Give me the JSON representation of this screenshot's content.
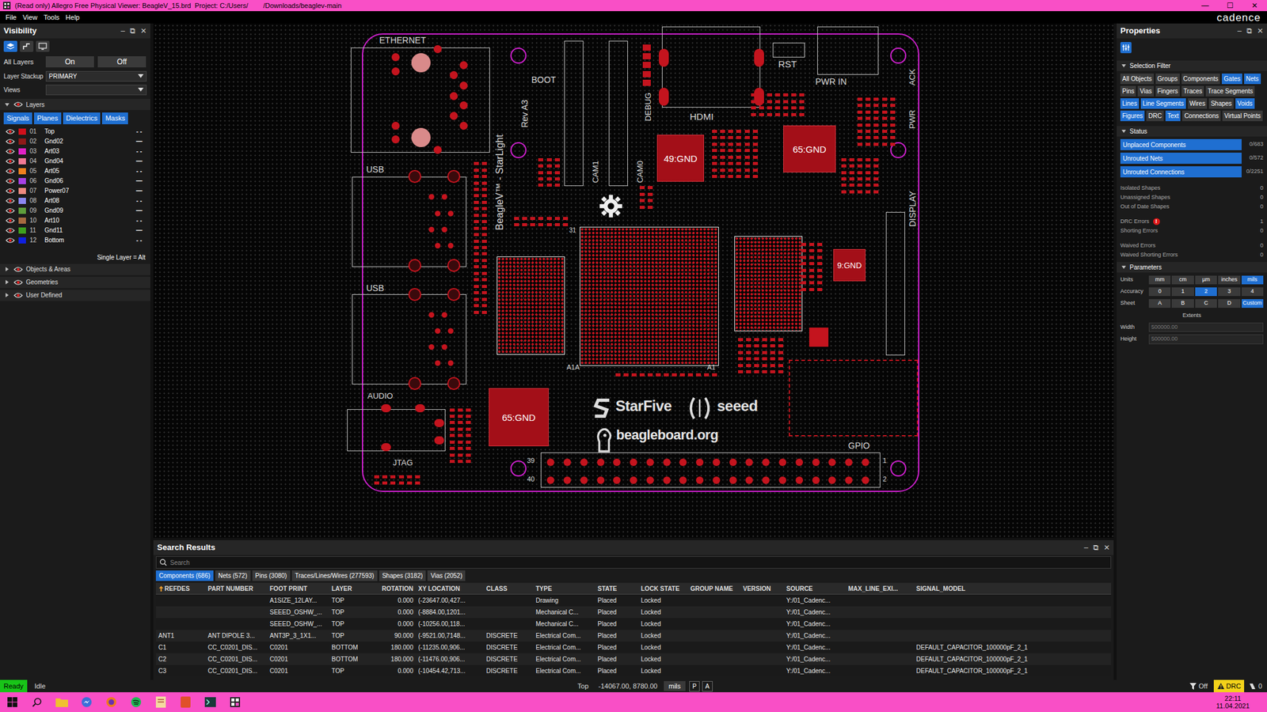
{
  "window": {
    "title": "(Read only) Allegro Free Physical Viewer: BeagleV_15.brd  Project: C:/Users/        /Downloads/beaglev-main",
    "controls": [
      "—",
      "☐",
      "✕"
    ]
  },
  "menu": [
    "File",
    "View",
    "Tools",
    "Help"
  ],
  "brand": "cadence",
  "visibility": {
    "title": "Visibility",
    "controls": [
      "–",
      "⧉",
      "✕"
    ],
    "view_tabs": [
      {
        "selected": true
      },
      {
        "selected": false
      },
      {
        "selected": false
      }
    ],
    "all_layers": {
      "label": "All Layers",
      "on": "On",
      "off": "Off"
    },
    "stackup": {
      "label": "Layer Stackup",
      "value": "PRIMARY"
    },
    "views": {
      "label": "Views",
      "value": ""
    },
    "layers_title": "Layers",
    "layers_expanded": true,
    "filters": [
      {
        "label": "Signals",
        "selected": true
      },
      {
        "label": "Planes",
        "selected": true
      },
      {
        "label": "Dielectrics",
        "selected": true
      },
      {
        "label": "Masks",
        "selected": true
      }
    ],
    "layers": [
      {
        "num": "01",
        "name": "Top",
        "color": "#d0101c",
        "visible": true,
        "style": "- -"
      },
      {
        "num": "02",
        "name": "Gnd02",
        "color": "#8e1a1a",
        "visible": true,
        "style": "—"
      },
      {
        "num": "03",
        "name": "Art03",
        "color": "#e021c4",
        "visible": true,
        "style": "- -"
      },
      {
        "num": "04",
        "name": "Gnd04",
        "color": "#f27a96",
        "visible": true,
        "style": "—"
      },
      {
        "num": "05",
        "name": "Art05",
        "color": "#f0801e",
        "visible": true,
        "style": "- -"
      },
      {
        "num": "06",
        "name": "Gnd06",
        "color": "#a640e6",
        "visible": true,
        "style": "—"
      },
      {
        "num": "07",
        "name": "Power07",
        "color": "#f08a80",
        "visible": true,
        "style": "—"
      },
      {
        "num": "08",
        "name": "Art08",
        "color": "#8a86f0",
        "visible": true,
        "style": "- -"
      },
      {
        "num": "09",
        "name": "Gnd09",
        "color": "#5e9e3c",
        "visible": true,
        "style": "—"
      },
      {
        "num": "10",
        "name": "Art10",
        "color": "#a66a40",
        "visible": true,
        "style": "- -"
      },
      {
        "num": "11",
        "name": "Gnd11",
        "color": "#3ea01e",
        "visible": true,
        "style": "—"
      },
      {
        "num": "12",
        "name": "Bottom",
        "color": "#1020e0",
        "visible": true,
        "style": "- -"
      }
    ],
    "hint": "Single Layer = Alt",
    "sections": [
      {
        "label": "Objects & Areas",
        "expanded": false
      },
      {
        "label": "Geometries",
        "expanded": false
      },
      {
        "label": "User Defined",
        "expanded": false
      }
    ]
  },
  "board": {
    "labels": [
      {
        "text": "ETHERNET",
        "kind": "silk"
      },
      {
        "text": "USB",
        "kind": "silk"
      },
      {
        "text": "USB",
        "kind": "silk"
      },
      {
        "text": "AUDIO",
        "kind": "silk"
      },
      {
        "text": "JTAG",
        "kind": "silk"
      },
      {
        "text": "BOOT",
        "kind": "silk"
      },
      {
        "text": "DEBUG",
        "kind": "vertical"
      },
      {
        "text": "CAM1",
        "kind": "vertical"
      },
      {
        "text": "CAM0",
        "kind": "vertical"
      },
      {
        "text": "HDMI",
        "kind": "silk"
      },
      {
        "text": "RST",
        "kind": "silk"
      },
      {
        "text": "PWR IN",
        "kind": "silk"
      },
      {
        "text": "ACK",
        "kind": "vertical"
      },
      {
        "text": "PWR",
        "kind": "vertical"
      },
      {
        "text": "DISPLAY",
        "kind": "vertical"
      },
      {
        "text": "GPIO",
        "kind": "silk"
      },
      {
        "text": "BeagleV™ - StarLight",
        "kind": "vertical"
      },
      {
        "text": "Rev A3",
        "kind": "vertical"
      },
      {
        "text": "31",
        "kind": "silk"
      },
      {
        "text": "A1A",
        "kind": "silk"
      },
      {
        "text": "A1",
        "kind": "silk"
      },
      {
        "text": "StarFive",
        "kind": "logo"
      },
      {
        "text": "seeed",
        "kind": "logo"
      },
      {
        "text": "beagleboard.org",
        "kind": "logo"
      },
      {
        "text": "39",
        "kind": "silk"
      },
      {
        "text": "40",
        "kind": "silk"
      },
      {
        "text": "1",
        "kind": "silk"
      },
      {
        "text": "2",
        "kind": "silk"
      }
    ],
    "pads": [
      {
        "label": "49:GND"
      },
      {
        "label": "65:GND"
      },
      {
        "label": "65:GND"
      },
      {
        "label": "9:GND"
      }
    ]
  },
  "properties": {
    "title": "Properties",
    "controls": [
      "–",
      "⧉",
      "✕"
    ],
    "selection_filter": {
      "title": "Selection Filter",
      "expanded": true,
      "buttons": [
        {
          "label": "All Objects",
          "selected": false
        },
        {
          "label": "Groups",
          "selected": false
        },
        {
          "label": "Components",
          "selected": false
        },
        {
          "label": "Gates",
          "selected": true
        },
        {
          "label": "Nets",
          "selected": true
        },
        {
          "label": "Pins",
          "selected": false
        },
        {
          "label": "Vias",
          "selected": false
        },
        {
          "label": "Fingers",
          "selected": false
        },
        {
          "label": "Traces",
          "selected": false
        },
        {
          "label": "Trace Segments",
          "selected": false
        },
        {
          "label": "Lines",
          "selected": true
        },
        {
          "label": "Line Segments",
          "selected": true
        },
        {
          "label": "Wires",
          "selected": false
        },
        {
          "label": "Shapes",
          "selected": false
        },
        {
          "label": "Voids",
          "selected": true
        },
        {
          "label": "Figures",
          "selected": true
        },
        {
          "label": "DRC",
          "selected": false
        },
        {
          "label": "Text",
          "selected": true
        },
        {
          "label": "Connections",
          "selected": false
        },
        {
          "label": "Virtual Points",
          "selected": false
        }
      ]
    },
    "status": {
      "title": "Status",
      "expanded": true,
      "bars": [
        {
          "label": "Unplaced Components",
          "count": "0/683"
        },
        {
          "label": "Unrouted Nets",
          "count": "0/572"
        },
        {
          "label": "Unrouted Connections",
          "count": "0/2251"
        }
      ],
      "rows": [
        {
          "label": "Isolated Shapes",
          "value": "0",
          "badge": ""
        },
        {
          "label": "Unassigned Shapes",
          "value": "0",
          "badge": ""
        },
        {
          "label": "Out of Date Shapes",
          "value": "0",
          "badge": ""
        },
        {
          "label": "DRC Errors",
          "value": "1",
          "badge": "!"
        },
        {
          "label": "Shorting Errors",
          "value": "0",
          "badge": ""
        },
        {
          "label": "Waived Errors",
          "value": "0",
          "badge": ""
        },
        {
          "label": "Waived Shorting Errors",
          "value": "0",
          "badge": ""
        }
      ]
    },
    "parameters": {
      "title": "Parameters",
      "expanded": true,
      "units": {
        "label": "Units",
        "options": [
          {
            "label": "mm",
            "selected": false
          },
          {
            "label": "cm",
            "selected": false
          },
          {
            "label": "µm",
            "selected": false
          },
          {
            "label": "inches",
            "selected": false
          },
          {
            "label": "mils",
            "selected": true
          }
        ]
      },
      "accuracy": {
        "label": "Accuracy",
        "options": [
          {
            "label": "0",
            "selected": false
          },
          {
            "label": "1",
            "selected": false
          },
          {
            "label": "2",
            "selected": true
          },
          {
            "label": "3",
            "selected": false
          },
          {
            "label": "4",
            "selected": false
          }
        ]
      },
      "sheet": {
        "label": "Sheet",
        "options": [
          {
            "label": "A",
            "selected": false
          },
          {
            "label": "B",
            "selected": false
          },
          {
            "label": "C",
            "selected": false
          },
          {
            "label": "D",
            "selected": false
          },
          {
            "label": "Custom",
            "selected": true
          }
        ]
      },
      "extents": "Extents",
      "width": {
        "label": "Width",
        "value": "500000.00"
      },
      "height": {
        "label": "Height",
        "value": "500000.00"
      }
    }
  },
  "search_results": {
    "title": "Search Results",
    "controls": [
      "–",
      "⧉",
      "✕"
    ],
    "search": {
      "placeholder": "Search"
    },
    "tabs": [
      {
        "label": "Components (686)",
        "selected": true
      },
      {
        "label": "Nets (572)",
        "selected": false
      },
      {
        "label": "Pins (3080)",
        "selected": false
      },
      {
        "label": "Traces/Lines/Wires (277593)",
        "selected": false
      },
      {
        "label": "Shapes (3182)",
        "selected": false
      },
      {
        "label": "Vias (2052)",
        "selected": false
      }
    ],
    "columns": [
      {
        "label": "REFDES",
        "sorted": true
      },
      {
        "label": "PART NUMBER",
        "sorted": false
      },
      {
        "label": "FOOT PRINT",
        "sorted": false
      },
      {
        "label": "LAYER",
        "sorted": false
      },
      {
        "label": "ROTATION",
        "sorted": false
      },
      {
        "label": "XY LOCATION",
        "sorted": false
      },
      {
        "label": "CLASS",
        "sorted": false
      },
      {
        "label": "TYPE",
        "sorted": false
      },
      {
        "label": "STATE",
        "sorted": false
      },
      {
        "label": "LOCK STATE",
        "sorted": false
      },
      {
        "label": "GROUP NAME",
        "sorted": false
      },
      {
        "label": "VERSION",
        "sorted": false
      },
      {
        "label": "SOURCE",
        "sorted": false
      },
      {
        "label": "MAX_LINE_EXI...",
        "sorted": false
      },
      {
        "label": "SIGNAL_MODEL",
        "sorted": false
      }
    ],
    "rows": [
      [
        "",
        "",
        "A1SIZE_12LAY...",
        "TOP",
        "0.000",
        "(-23647.00,427...",
        "",
        "Drawing",
        "Placed",
        "Locked",
        "",
        "",
        "Y:/01_Cadenc...",
        "",
        ""
      ],
      [
        "",
        "",
        "SEEED_OSHW_...",
        "TOP",
        "0.000",
        "(-8884.00,1201...",
        "",
        "Mechanical C...",
        "Placed",
        "Locked",
        "",
        "",
        "Y:/01_Cadenc...",
        "",
        ""
      ],
      [
        "",
        "",
        "SEEED_OSHW_...",
        "TOP",
        "0.000",
        "(-10256.00,118...",
        "",
        "Mechanical C...",
        "Placed",
        "Locked",
        "",
        "",
        "Y:/01_Cadenc...",
        "",
        ""
      ],
      [
        "ANT1",
        "ANT DIPOLE 3...",
        "ANT3P_3_1X1...",
        "TOP",
        "90.000",
        "(-9521.00,7148...",
        "DISCRETE",
        "Electrical Com...",
        "Placed",
        "Locked",
        "",
        "",
        "Y:/01_Cadenc...",
        "",
        ""
      ],
      [
        "C1",
        "CC_C0201_DIS...",
        "C0201",
        "BOTTOM",
        "180.000",
        "(-11235.00,906...",
        "DISCRETE",
        "Electrical Com...",
        "Placed",
        "Locked",
        "",
        "",
        "Y:/01_Cadenc...",
        "",
        "DEFAULT_CAPACITOR_100000pF_2_1"
      ],
      [
        "C2",
        "CC_C0201_DIS...",
        "C0201",
        "BOTTOM",
        "180.000",
        "(-11476.00,906...",
        "DISCRETE",
        "Electrical Com...",
        "Placed",
        "Locked",
        "",
        "",
        "Y:/01_Cadenc...",
        "",
        "DEFAULT_CAPACITOR_100000pF_2_1"
      ],
      [
        "C3",
        "CC_C0201_DIS...",
        "C0201",
        "TOP",
        "0.000",
        "(-10454.42,713...",
        "DISCRETE",
        "Electrical Com...",
        "Placed",
        "Locked",
        "",
        "",
        "Y:/01_Cadenc...",
        "",
        "DEFAULT_CAPACITOR_100000pF_2_1"
      ]
    ]
  },
  "status_bar": {
    "state": "Ready",
    "activity": "Idle",
    "layer": "Top",
    "coords": "-14067.00, 8780.00",
    "units": "mils",
    "p": "P",
    "a": "A",
    "filter": "Off",
    "drc": "DRC",
    "count": "0"
  },
  "taskbar": {
    "time": "22:11",
    "date": "11.04.2021"
  }
}
